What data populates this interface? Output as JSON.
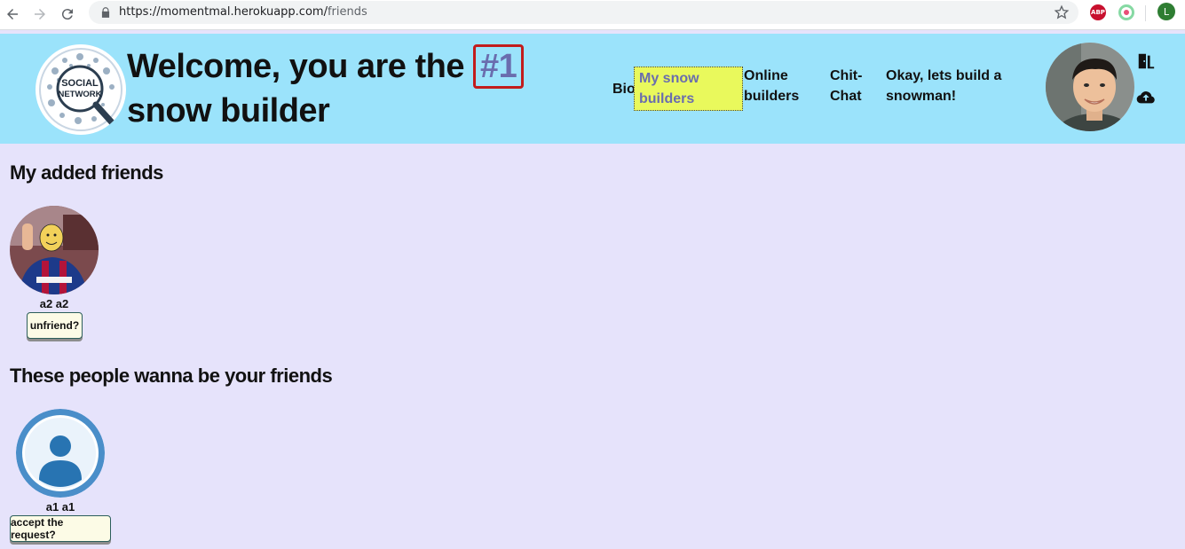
{
  "browser": {
    "url_origin": "https://momentmal.herokuapp.com/",
    "url_path": "friends",
    "abp_label": "ABP",
    "profile_initial": "L",
    "icons": [
      "back-icon",
      "forward-icon",
      "reload-icon",
      "lock-icon",
      "bookmark-star-icon"
    ]
  },
  "header": {
    "welcome_prefix": "Welcome, you are the",
    "rank": "#1",
    "welcome_suffix": "snow builder",
    "logo_text_top": "SOCIAL",
    "logo_text_bottom": "NETWORK",
    "nav": {
      "bio": "Bio",
      "my_snow_builders": "My snow builders",
      "online_builders": "Online builders",
      "chit_chat": "Chit-Chat",
      "build_snowman": "Okay, lets build a snowman!"
    },
    "icons": [
      "logout-door-icon",
      "cloud-upload-icon"
    ]
  },
  "added_friends": {
    "title": "My added friends",
    "items": [
      {
        "name": "a2 a2",
        "action": "unfriend?"
      }
    ]
  },
  "friend_requests": {
    "title": "These people wanna be your friends",
    "items": [
      {
        "name": "a1 a1",
        "action": "accept the request?"
      }
    ]
  },
  "colors": {
    "header_bg": "#9be3fb",
    "page_bg": "#e6e3fb",
    "highlight": "#e9f95c",
    "rank_border": "#c21c1c",
    "rank_text": "#6a6dae"
  }
}
